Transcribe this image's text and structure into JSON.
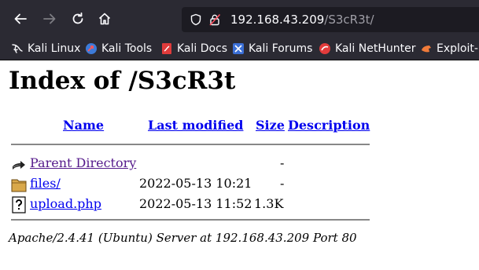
{
  "browser": {
    "url_host": "192.168.43.209",
    "url_path": "/S3cR3t/"
  },
  "bookmarks": [
    {
      "label": "Kali Linux",
      "icon": "kali-dragon-icon"
    },
    {
      "label": "Kali Tools",
      "icon": "kali-tools-icon"
    },
    {
      "label": "Kali Docs",
      "icon": "kali-docs-icon"
    },
    {
      "label": "Kali Forums",
      "icon": "kali-forums-icon"
    },
    {
      "label": "Kali NetHunter",
      "icon": "nethunter-icon"
    },
    {
      "label": "Exploit-D",
      "icon": "exploit-db-icon"
    }
  ],
  "page": {
    "title": "Index of /S3cR3t",
    "columns": {
      "name": "Name",
      "last_modified": "Last modified",
      "size": "Size",
      "description": "Description"
    },
    "rows": [
      {
        "name": "Parent Directory",
        "modified": "",
        "size": "-",
        "icon": "back-arrow-icon"
      },
      {
        "name": "files/",
        "modified": "2022-05-13 10:21",
        "size": "-",
        "icon": "folder-icon"
      },
      {
        "name": "upload.php",
        "modified": "2022-05-13 11:52",
        "size": "1.3K",
        "icon": "unknown-file-icon"
      }
    ],
    "footer": "Apache/2.4.41 (Ubuntu) Server at 192.168.43.209 Port 80"
  }
}
